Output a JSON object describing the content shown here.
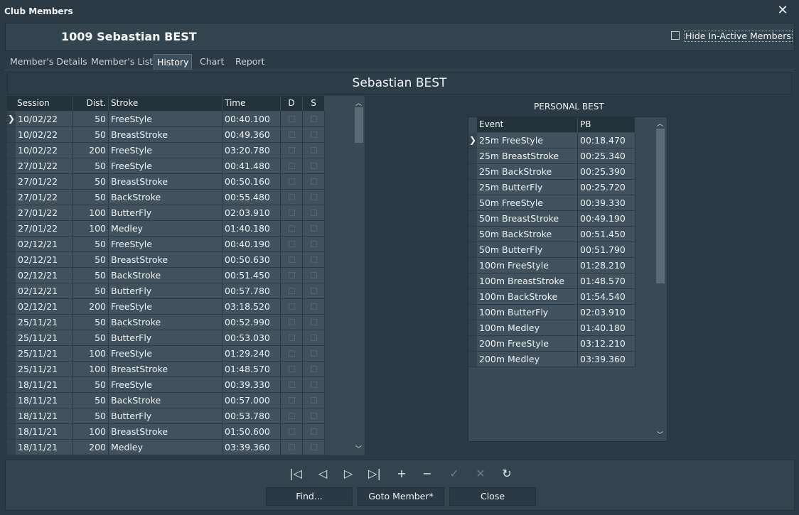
{
  "window": {
    "title": "Club Members",
    "close_label": "✕"
  },
  "header": {
    "member_name": "1009 Sebastian BEST",
    "hide_inactive_label": "Hide In-Active Members",
    "hide_inactive_checked": false
  },
  "tabs": [
    "Member's Details",
    "Member's List",
    "History",
    "Chart",
    "Report"
  ],
  "active_tab": "History",
  "panel_title": "Sebastian BEST",
  "history": {
    "columns": [
      "Session",
      "Dist.",
      "Stroke",
      "Time",
      "D",
      "S"
    ],
    "rows": [
      [
        "10/02/22",
        "50",
        "FreeStyle",
        "00:40.100"
      ],
      [
        "10/02/22",
        "50",
        "BreastStroke",
        "00:49.360"
      ],
      [
        "10/02/22",
        "200",
        "FreeStyle",
        "03:20.780"
      ],
      [
        "27/01/22",
        "50",
        "FreeStyle",
        "00:41.480"
      ],
      [
        "27/01/22",
        "50",
        "BreastStroke",
        "00:50.160"
      ],
      [
        "27/01/22",
        "50",
        "BackStroke",
        "00:55.480"
      ],
      [
        "27/01/22",
        "100",
        "ButterFly",
        "02:03.910"
      ],
      [
        "27/01/22",
        "100",
        "Medley",
        "01:40.180"
      ],
      [
        "02/12/21",
        "50",
        "FreeStyle",
        "00:40.190"
      ],
      [
        "02/12/21",
        "50",
        "BreastStroke",
        "00:50.630"
      ],
      [
        "02/12/21",
        "50",
        "BackStroke",
        "00:51.450"
      ],
      [
        "02/12/21",
        "50",
        "ButterFly",
        "00:57.780"
      ],
      [
        "02/12/21",
        "200",
        "FreeStyle",
        "03:18.520"
      ],
      [
        "25/11/21",
        "50",
        "BackStroke",
        "00:52.990"
      ],
      [
        "25/11/21",
        "50",
        "ButterFly",
        "00:53.030"
      ],
      [
        "25/11/21",
        "100",
        "FreeStyle",
        "01:29.240"
      ],
      [
        "25/11/21",
        "100",
        "BreastStroke",
        "01:48.570"
      ],
      [
        "18/11/21",
        "50",
        "FreeStyle",
        "00:39.330"
      ],
      [
        "18/11/21",
        "50",
        "BackStroke",
        "00:57.000"
      ],
      [
        "18/11/21",
        "50",
        "ButterFly",
        "00:53.780"
      ],
      [
        "18/11/21",
        "100",
        "BreastStroke",
        "01:50.600"
      ],
      [
        "18/11/21",
        "200",
        "Medley",
        "03:39.360"
      ]
    ]
  },
  "personal_best": {
    "title": "PERSONAL BEST",
    "columns": [
      "Event",
      "PB"
    ],
    "rows": [
      [
        "25m FreeStyle",
        "00:18.470"
      ],
      [
        "25m BreastStroke",
        "00:25.340"
      ],
      [
        "25m BackStroke",
        "00:25.390"
      ],
      [
        "25m ButterFly",
        "00:25.720"
      ],
      [
        "50m FreeStyle",
        "00:39.330"
      ],
      [
        "50m BreastStroke",
        "00:49.190"
      ],
      [
        "50m BackStroke",
        "00:51.450"
      ],
      [
        "50m ButterFly",
        "00:51.790"
      ],
      [
        "100m FreeStyle",
        "01:28.210"
      ],
      [
        "100m BreastStroke",
        "01:48.570"
      ],
      [
        "100m BackStroke",
        "01:54.540"
      ],
      [
        "100m ButterFly",
        "02:03.910"
      ],
      [
        "100m Medley",
        "01:40.180"
      ],
      [
        "200m FreeStyle",
        "03:12.210"
      ],
      [
        "200m Medley",
        "03:39.360"
      ]
    ]
  },
  "navigator": [
    {
      "name": "first-record-icon",
      "glyph": "|◁",
      "enabled": true
    },
    {
      "name": "prior-record-icon",
      "glyph": "◁",
      "enabled": true
    },
    {
      "name": "next-record-icon",
      "glyph": "▷",
      "enabled": true
    },
    {
      "name": "last-record-icon",
      "glyph": "▷|",
      "enabled": true
    },
    {
      "name": "insert-record-icon",
      "glyph": "+",
      "enabled": true
    },
    {
      "name": "delete-record-icon",
      "glyph": "−",
      "enabled": true
    },
    {
      "name": "post-record-icon",
      "glyph": "✓",
      "enabled": false
    },
    {
      "name": "cancel-edit-icon",
      "glyph": "✕",
      "enabled": false
    },
    {
      "name": "refresh-icon",
      "glyph": "↻",
      "enabled": true
    }
  ],
  "buttons": {
    "find": "Find...",
    "goto": "Goto Member*",
    "close": "Close"
  },
  "colors": {
    "background": "#2b3a45",
    "row_bg": "#41525e",
    "header_bg": "#24323c"
  }
}
